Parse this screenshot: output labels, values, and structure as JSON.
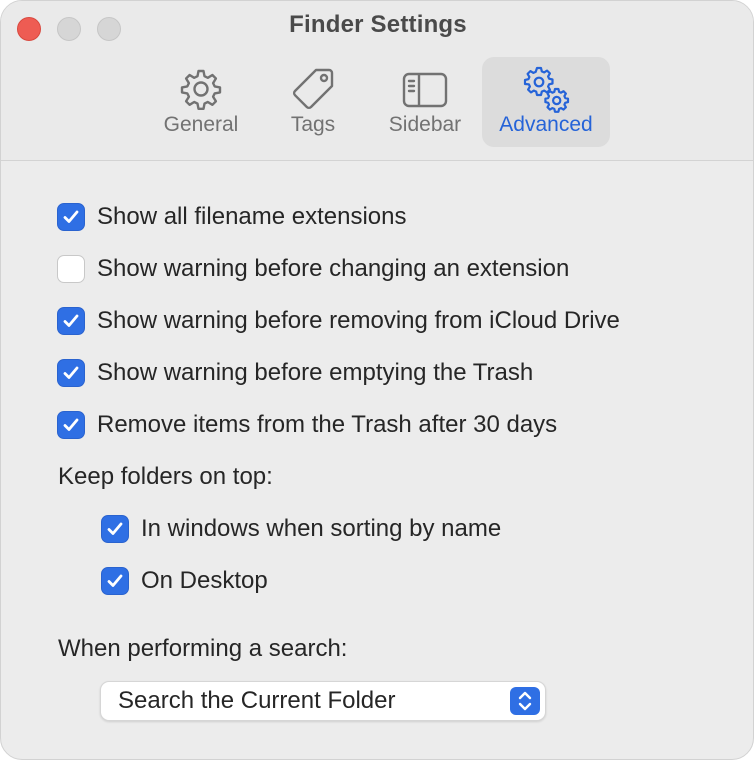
{
  "window": {
    "title": "Finder Settings"
  },
  "tabs": [
    {
      "label": "General",
      "icon": "gear-icon",
      "active": false
    },
    {
      "label": "Tags",
      "icon": "tag-icon",
      "active": false
    },
    {
      "label": "Sidebar",
      "icon": "sidebar-icon",
      "active": false
    },
    {
      "label": "Advanced",
      "icon": "gears-icon",
      "active": true
    }
  ],
  "options": [
    {
      "label": "Show all filename extensions",
      "checked": true
    },
    {
      "label": "Show warning before changing an extension",
      "checked": false
    },
    {
      "label": "Show warning before removing from iCloud Drive",
      "checked": true
    },
    {
      "label": "Show warning before emptying the Trash",
      "checked": true
    },
    {
      "label": "Remove items from the Trash after 30 days",
      "checked": true
    }
  ],
  "folders_on_top": {
    "heading": "Keep folders on top:",
    "options": [
      {
        "label": "In windows when sorting by name",
        "checked": true
      },
      {
        "label": "On Desktop",
        "checked": true
      }
    ]
  },
  "search": {
    "heading": "When performing a search:",
    "selected": "Search the Current Folder"
  },
  "colors": {
    "accent": "#2f6fe4",
    "close": "#ee5c53"
  }
}
